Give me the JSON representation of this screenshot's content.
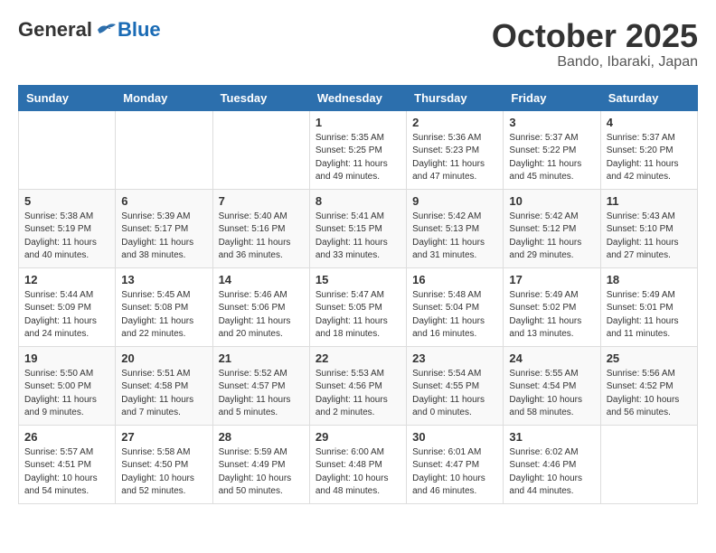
{
  "header": {
    "logo_general": "General",
    "logo_blue": "Blue",
    "month_title": "October 2025",
    "subtitle": "Bando, Ibaraki, Japan"
  },
  "days_of_week": [
    "Sunday",
    "Monday",
    "Tuesday",
    "Wednesday",
    "Thursday",
    "Friday",
    "Saturday"
  ],
  "weeks": [
    [
      {
        "day": "",
        "info": ""
      },
      {
        "day": "",
        "info": ""
      },
      {
        "day": "",
        "info": ""
      },
      {
        "day": "1",
        "info": "Sunrise: 5:35 AM\nSunset: 5:25 PM\nDaylight: 11 hours\nand 49 minutes."
      },
      {
        "day": "2",
        "info": "Sunrise: 5:36 AM\nSunset: 5:23 PM\nDaylight: 11 hours\nand 47 minutes."
      },
      {
        "day": "3",
        "info": "Sunrise: 5:37 AM\nSunset: 5:22 PM\nDaylight: 11 hours\nand 45 minutes."
      },
      {
        "day": "4",
        "info": "Sunrise: 5:37 AM\nSunset: 5:20 PM\nDaylight: 11 hours\nand 42 minutes."
      }
    ],
    [
      {
        "day": "5",
        "info": "Sunrise: 5:38 AM\nSunset: 5:19 PM\nDaylight: 11 hours\nand 40 minutes."
      },
      {
        "day": "6",
        "info": "Sunrise: 5:39 AM\nSunset: 5:17 PM\nDaylight: 11 hours\nand 38 minutes."
      },
      {
        "day": "7",
        "info": "Sunrise: 5:40 AM\nSunset: 5:16 PM\nDaylight: 11 hours\nand 36 minutes."
      },
      {
        "day": "8",
        "info": "Sunrise: 5:41 AM\nSunset: 5:15 PM\nDaylight: 11 hours\nand 33 minutes."
      },
      {
        "day": "9",
        "info": "Sunrise: 5:42 AM\nSunset: 5:13 PM\nDaylight: 11 hours\nand 31 minutes."
      },
      {
        "day": "10",
        "info": "Sunrise: 5:42 AM\nSunset: 5:12 PM\nDaylight: 11 hours\nand 29 minutes."
      },
      {
        "day": "11",
        "info": "Sunrise: 5:43 AM\nSunset: 5:10 PM\nDaylight: 11 hours\nand 27 minutes."
      }
    ],
    [
      {
        "day": "12",
        "info": "Sunrise: 5:44 AM\nSunset: 5:09 PM\nDaylight: 11 hours\nand 24 minutes."
      },
      {
        "day": "13",
        "info": "Sunrise: 5:45 AM\nSunset: 5:08 PM\nDaylight: 11 hours\nand 22 minutes."
      },
      {
        "day": "14",
        "info": "Sunrise: 5:46 AM\nSunset: 5:06 PM\nDaylight: 11 hours\nand 20 minutes."
      },
      {
        "day": "15",
        "info": "Sunrise: 5:47 AM\nSunset: 5:05 PM\nDaylight: 11 hours\nand 18 minutes."
      },
      {
        "day": "16",
        "info": "Sunrise: 5:48 AM\nSunset: 5:04 PM\nDaylight: 11 hours\nand 16 minutes."
      },
      {
        "day": "17",
        "info": "Sunrise: 5:49 AM\nSunset: 5:02 PM\nDaylight: 11 hours\nand 13 minutes."
      },
      {
        "day": "18",
        "info": "Sunrise: 5:49 AM\nSunset: 5:01 PM\nDaylight: 11 hours\nand 11 minutes."
      }
    ],
    [
      {
        "day": "19",
        "info": "Sunrise: 5:50 AM\nSunset: 5:00 PM\nDaylight: 11 hours\nand 9 minutes."
      },
      {
        "day": "20",
        "info": "Sunrise: 5:51 AM\nSunset: 4:58 PM\nDaylight: 11 hours\nand 7 minutes."
      },
      {
        "day": "21",
        "info": "Sunrise: 5:52 AM\nSunset: 4:57 PM\nDaylight: 11 hours\nand 5 minutes."
      },
      {
        "day": "22",
        "info": "Sunrise: 5:53 AM\nSunset: 4:56 PM\nDaylight: 11 hours\nand 2 minutes."
      },
      {
        "day": "23",
        "info": "Sunrise: 5:54 AM\nSunset: 4:55 PM\nDaylight: 11 hours\nand 0 minutes."
      },
      {
        "day": "24",
        "info": "Sunrise: 5:55 AM\nSunset: 4:54 PM\nDaylight: 10 hours\nand 58 minutes."
      },
      {
        "day": "25",
        "info": "Sunrise: 5:56 AM\nSunset: 4:52 PM\nDaylight: 10 hours\nand 56 minutes."
      }
    ],
    [
      {
        "day": "26",
        "info": "Sunrise: 5:57 AM\nSunset: 4:51 PM\nDaylight: 10 hours\nand 54 minutes."
      },
      {
        "day": "27",
        "info": "Sunrise: 5:58 AM\nSunset: 4:50 PM\nDaylight: 10 hours\nand 52 minutes."
      },
      {
        "day": "28",
        "info": "Sunrise: 5:59 AM\nSunset: 4:49 PM\nDaylight: 10 hours\nand 50 minutes."
      },
      {
        "day": "29",
        "info": "Sunrise: 6:00 AM\nSunset: 4:48 PM\nDaylight: 10 hours\nand 48 minutes."
      },
      {
        "day": "30",
        "info": "Sunrise: 6:01 AM\nSunset: 4:47 PM\nDaylight: 10 hours\nand 46 minutes."
      },
      {
        "day": "31",
        "info": "Sunrise: 6:02 AM\nSunset: 4:46 PM\nDaylight: 10 hours\nand 44 minutes."
      },
      {
        "day": "",
        "info": ""
      }
    ]
  ]
}
